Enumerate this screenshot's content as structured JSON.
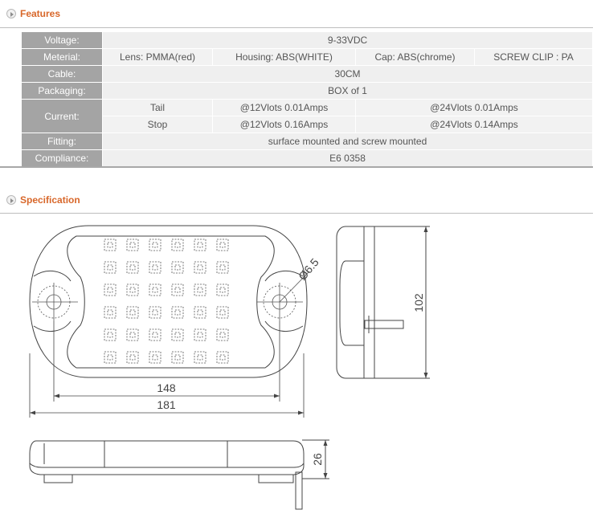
{
  "features": {
    "title": "Features",
    "voltage": {
      "label": "Voltage:",
      "value": "9-33VDC"
    },
    "material": {
      "label": "Meterial:",
      "lens": "Lens:  PMMA(red)",
      "housing": "Housing:  ABS(WHITE)",
      "cap": "Cap:  ABS(chrome)",
      "clip": "SCREW CLIP : PA"
    },
    "cable": {
      "label": "Cable:",
      "value": "30CM"
    },
    "packaging": {
      "label": "Packaging:",
      "value": "BOX of 1"
    },
    "current": {
      "label": "Current:",
      "tail": {
        "name": "Tail",
        "v12": "@12Vlots  0.01Amps",
        "v24": "@24Vlots  0.01Amps"
      },
      "stop": {
        "name": "Stop",
        "v12": "@12Vlots  0.16Amps",
        "v24": "@24Vlots  0.14Amps"
      }
    },
    "fitting": {
      "label": "Fitting:",
      "value": "surface mounted and screw mounted"
    },
    "compliance": {
      "label": "Compliance:",
      "value": "E6 0358"
    }
  },
  "specification": {
    "title": "Specification",
    "dim_hole": "Ø6.5",
    "dim_inner_width": "148",
    "dim_outer_width": "181",
    "dim_height": "102",
    "dim_depth": "26"
  },
  "colors": {
    "accent": "#d8672a",
    "label_bg": "#a4a4a4",
    "cell_bg": "#f2f2f2",
    "line": "#444444"
  }
}
